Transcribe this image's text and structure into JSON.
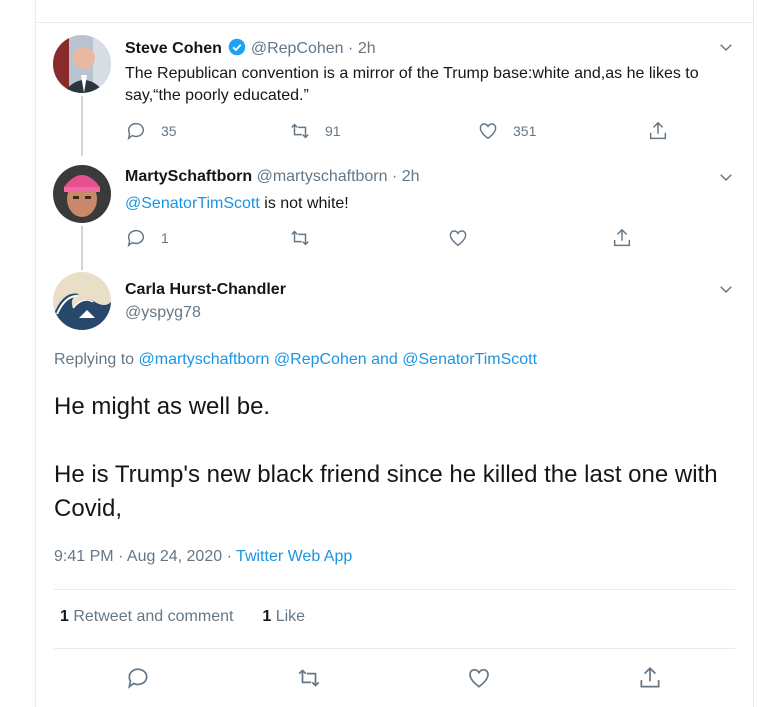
{
  "tweets": [
    {
      "name": "Steve Cohen",
      "verified": true,
      "handle": "@RepCohen",
      "time": "2h",
      "text": "The Republican convention is a mirror of the Trump base:white and,as he likes to say,“the poorly educated.”",
      "replies": "35",
      "retweets": "91",
      "likes": "351"
    },
    {
      "name": "MartySchaftborn",
      "handle": "@martyschaftborn",
      "time": "2h",
      "mention": "@SenatorTimScott",
      "text": " is not white!",
      "replies": "1",
      "retweets": "",
      "likes": ""
    }
  ],
  "focused": {
    "name": "Carla Hurst-Chandler",
    "handle": "@yspyg78",
    "replying_prefix": "Replying to ",
    "replying_user1": "@martyschaftborn",
    "replying_user2": "@RepCohen",
    "replying_and": " and ",
    "replying_user3": "@SenatorTimScott",
    "text_line1": "He might as well be.",
    "text_line2": "He is Trump's new black friend since he killed the last one with Covid,",
    "time": "9:41 PM · Aug 24, 2020 · ",
    "source": "Twitter Web App",
    "retweet_count": "1",
    "retweet_label": " Retweet and comment",
    "like_count": "1",
    "like_label": " Like"
  },
  "icons": [
    "reply-icon",
    "retweet-icon",
    "like-icon",
    "share-icon",
    "chevron-down-icon",
    "verified-badge-icon"
  ],
  "colors": {
    "accent": "#1b95e0",
    "muted": "#657786",
    "text": "#14171a",
    "border": "#e6ecf0"
  }
}
